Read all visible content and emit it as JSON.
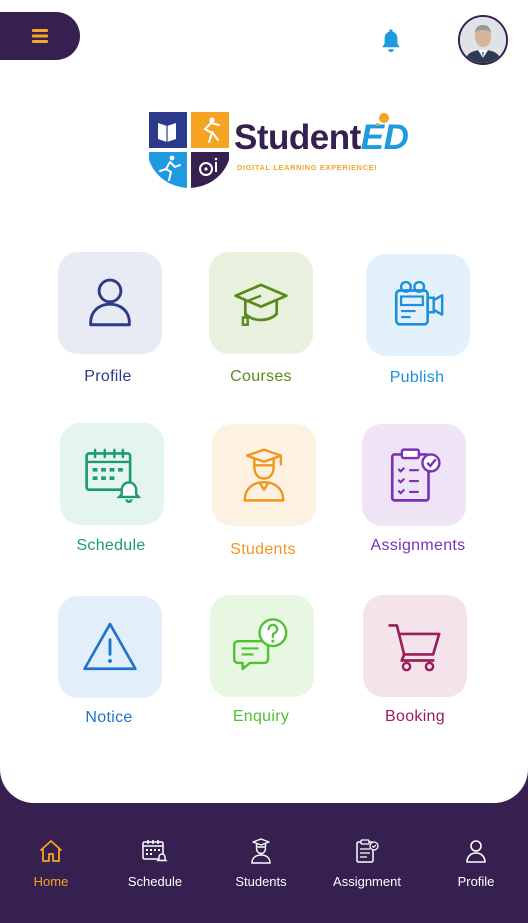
{
  "logo": {
    "word_main": "Student",
    "word_accent": "ED",
    "tagline": "DIGITAL LEARNING EXPERIENCE!"
  },
  "colors": {
    "brand_dark": "#35204f",
    "accent_orange": "#f5a523",
    "bell_blue": "#1e9be0"
  },
  "grid": [
    {
      "label": "Profile",
      "icon": "user-icon",
      "color": "#2b3a8a",
      "bg": "#e8eaf4"
    },
    {
      "label": "Courses",
      "icon": "graduation-cap-icon",
      "color": "#5a8a1c",
      "bg": "#e8f1dd"
    },
    {
      "label": "Publish",
      "icon": "camera-icon",
      "color": "#1e8fd8",
      "bg": "#e2f1fb"
    },
    {
      "label": "Schedule",
      "icon": "calendar-icon",
      "color": "#1f9a78",
      "bg": "#e4f5ee"
    },
    {
      "label": "Students",
      "icon": "student-icon",
      "color": "#f0961e",
      "bg": "#fdf1e1"
    },
    {
      "label": "Assignments",
      "icon": "clipboard-icon",
      "color": "#7a32b8",
      "bg": "#efe4f6"
    },
    {
      "label": "Notice",
      "icon": "warning-icon",
      "color": "#1d74c9",
      "bg": "#e3eefb"
    },
    {
      "label": "Enquiry",
      "icon": "chat-question-icon",
      "color": "#4fc231",
      "bg": "#e7f7e1"
    },
    {
      "label": "Booking",
      "icon": "cart-icon",
      "color": "#9a1e5a",
      "bg": "#f5e3ec"
    }
  ],
  "tabs": [
    {
      "label": "Home",
      "icon": "home-icon",
      "active": true
    },
    {
      "label": "Schedule",
      "icon": "calendar-icon",
      "active": false
    },
    {
      "label": "Students",
      "icon": "student-icon",
      "active": false
    },
    {
      "label": "Assignment",
      "icon": "clipboard-icon",
      "active": false
    },
    {
      "label": "Profile",
      "icon": "user-icon",
      "active": false
    }
  ]
}
